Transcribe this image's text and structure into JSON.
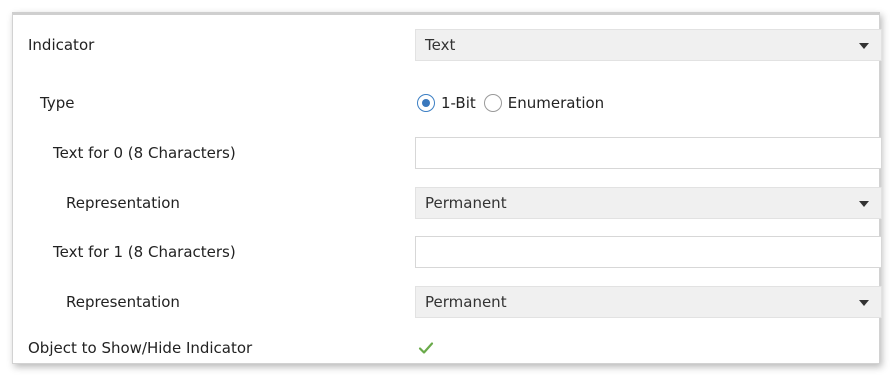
{
  "rows": {
    "indicator": {
      "label": "Indicator",
      "value": "Text"
    },
    "type": {
      "label": "Type",
      "options": [
        "1-Bit",
        "Enumeration"
      ],
      "selected": "1-Bit"
    },
    "text0": {
      "label": "Text for 0 (8 Characters)",
      "value": ""
    },
    "rep0": {
      "label": "Representation",
      "value": "Permanent"
    },
    "text1": {
      "label": "Text for 1 (8 Characters)",
      "value": ""
    },
    "rep1": {
      "label": "Representation",
      "value": "Permanent"
    },
    "object_show_hide": {
      "label": "Object to Show/Hide Indicator",
      "checked": true
    }
  },
  "colors": {
    "accent": "#3a78bd",
    "check": "#6aaa4a",
    "dropdown_bg": "#f0f0f0"
  },
  "icons": {
    "dropdown_arrow": "chevron-down-icon",
    "checkmark": "checkmark-icon"
  }
}
